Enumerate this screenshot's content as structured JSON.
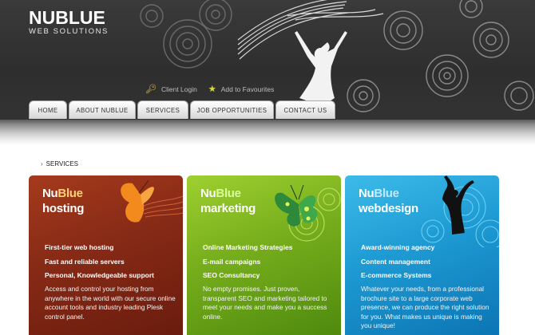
{
  "brand": {
    "name": "NUBLUE",
    "tagline": "WEB SOLUTIONS"
  },
  "toplinks": [
    {
      "label": "Client Login",
      "icon": "key-icon"
    },
    {
      "label": "Add to Favourites",
      "icon": "star-icon"
    }
  ],
  "nav": [
    "HOME",
    "ABOUT NUBLUE",
    "SERVICES",
    "JOB OPPORTUNITIES",
    "CONTACT US"
  ],
  "breadcrumb": "SERVICES",
  "colors": {
    "header_bg": "#333333",
    "hosting": "#862a16",
    "marketing": "#76ad1c",
    "webdesign": "#1e9ad3"
  },
  "panels": [
    {
      "brand_nu": "Nu",
      "brand_blue": "Blue",
      "title": "hosting",
      "features": [
        "First-tier web hosting",
        "Fast and reliable servers",
        "Personal, Knowledgeable support"
      ],
      "description": "Access and control your hosting from anywhere in the world with our secure online account tools and industry leading Plesk control panel."
    },
    {
      "brand_nu": "Nu",
      "brand_blue": "Blue",
      "title": "marketing",
      "features": [
        "Online Marketing Strategies",
        "E-mail campaigns",
        "SEO Consultancy"
      ],
      "description": "No empty promises. Just proven, transparent SEO and marketing tailored to meet your needs and make you a success online."
    },
    {
      "brand_nu": "Nu",
      "brand_blue": "Blue",
      "title": "webdesign",
      "features": [
        "Award-winning agency",
        "Content management",
        "E-commerce Systems"
      ],
      "description": "Whatever your needs, from a professional brochure site to a large corporate web presence, we can produce the right solution for you. What makes us unique is making you unique!"
    }
  ]
}
